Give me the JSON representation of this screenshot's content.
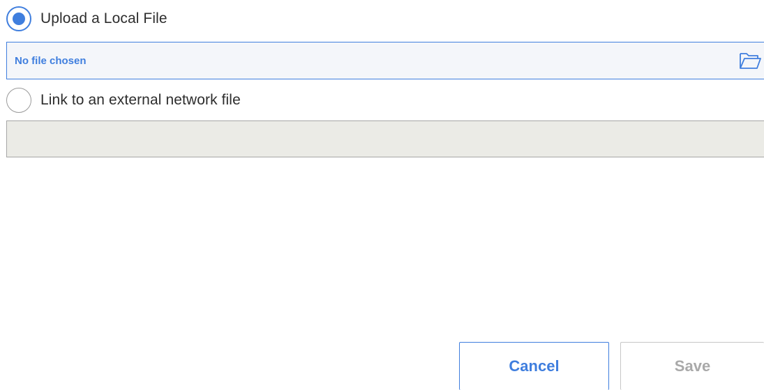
{
  "options": {
    "upload_local": {
      "label": "Upload a Local File",
      "selected": true
    },
    "link_external": {
      "label": "Link to an external network file",
      "selected": false
    }
  },
  "file_input": {
    "value": "No file chosen",
    "icon": "folder-open-icon"
  },
  "link_input": {
    "value": ""
  },
  "buttons": {
    "cancel_label": "Cancel",
    "save_label": "Save"
  },
  "colors": {
    "accent": "#3f7ede",
    "disabled_text": "#a9a9a9",
    "disabled_field": "#ebebe6"
  }
}
